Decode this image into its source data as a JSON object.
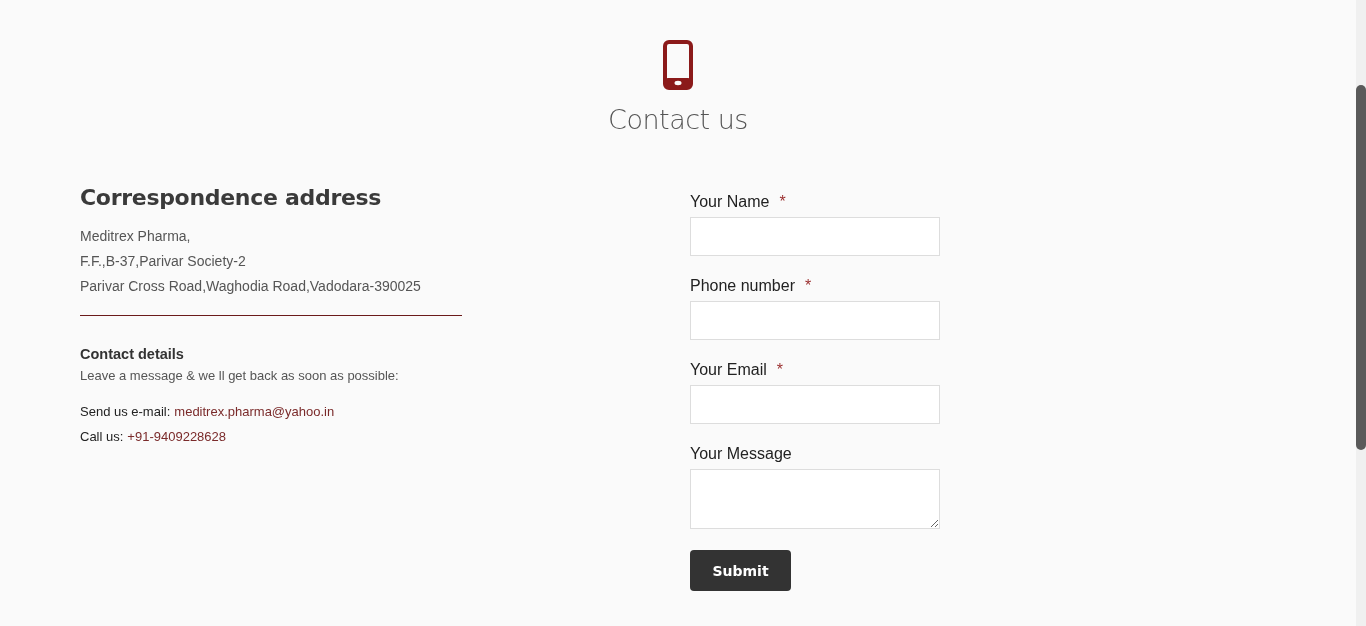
{
  "header": {
    "title": "Contact us"
  },
  "address": {
    "heading": "Correspondence address",
    "lines": [
      "Meditrex Pharma,",
      "F.F.,B-37,Parivar Society-2",
      "Parivar Cross Road,Waghodia Road,Vadodara-390025"
    ]
  },
  "contact_details": {
    "heading": "Contact details",
    "note": "Leave a message & we ll get back as soon as possible:",
    "items": [
      {
        "label": "Send us e-mail:",
        "link": "meditrex.pharma@yahoo.in"
      },
      {
        "label": "Call us:",
        "link": "+91-9409228628"
      }
    ]
  },
  "form": {
    "required_mark": "*",
    "fields": [
      {
        "label": "Your Name",
        "kind": "input",
        "required": true
      },
      {
        "label": "Phone number",
        "kind": "input",
        "required": true
      },
      {
        "label": "Your Email",
        "kind": "input",
        "required": true
      },
      {
        "label": "Your Message",
        "kind": "textarea",
        "required": false
      }
    ],
    "submit": "Submit"
  }
}
